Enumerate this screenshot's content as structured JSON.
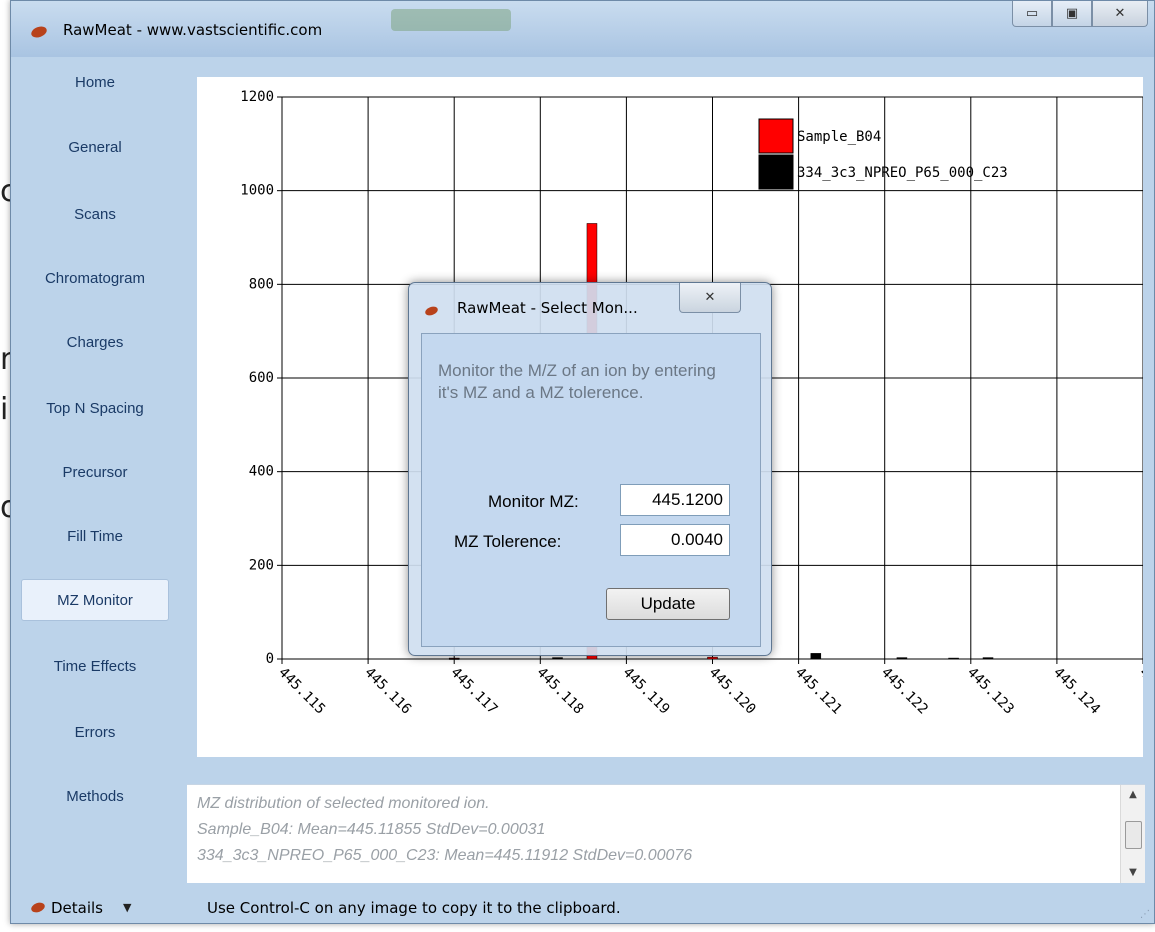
{
  "window": {
    "title": "RawMeat - www.vastscientific.com",
    "controls": [
      "minimize",
      "maximize",
      "close"
    ]
  },
  "sidebar": {
    "items": [
      {
        "label": "Home"
      },
      {
        "label": "General"
      },
      {
        "label": "Scans"
      },
      {
        "label": "Chromatogram"
      },
      {
        "label": "Charges"
      },
      {
        "label": "Top N Spacing"
      },
      {
        "label": "Precursor"
      },
      {
        "label": "Fill Time"
      },
      {
        "label": "MZ Monitor",
        "active": true
      },
      {
        "label": "Time Effects"
      },
      {
        "label": "Errors"
      },
      {
        "label": "Methods"
      }
    ]
  },
  "chart_data": {
    "type": "bar",
    "xlabel": "",
    "ylabel": "",
    "ylim": [
      0,
      1200
    ],
    "yticks": [
      0,
      200,
      400,
      600,
      800,
      1000,
      1200
    ],
    "xlim": [
      445.115,
      445.125
    ],
    "xticks": [
      "445.115",
      "445.116",
      "445.117",
      "445.118",
      "445.119",
      "445.120",
      "445.121",
      "445.122",
      "445.123",
      "445.124",
      "445.12"
    ],
    "grid": true,
    "legend_position": "top-right",
    "series": [
      {
        "name": "Sample_B04",
        "color": "#ff0000",
        "x": [
          445.117,
          445.1186,
          445.12
        ],
        "values": [
          2,
          930,
          4
        ]
      },
      {
        "name": "334_3c3_NPREO_P65_000_C23",
        "color": "#000000",
        "x": [
          445.117,
          445.1182,
          445.1212,
          445.1222,
          445.1228,
          445.1232
        ],
        "values": [
          1,
          3,
          12,
          3,
          2,
          3
        ]
      }
    ]
  },
  "info": {
    "lines": [
      "MZ distribution of selected monitored ion.",
      "Sample_B04: Mean=445.11855 StdDev=0.00031",
      "334_3c3_NPREO_P65_000_C23: Mean=445.11912 StdDev=0.00076"
    ]
  },
  "statusbar": {
    "details_label": "Details",
    "text": "Use Control-C on any image to copy it to the clipboard."
  },
  "dialog": {
    "title": "RawMeat - Select Mon...",
    "description": "Monitor the M/Z of an ion by entering it's MZ and a MZ tolerence.",
    "monitor_label": "Monitor MZ:",
    "monitor_value": "445.1200",
    "tolerance_label": "MZ Tolerence:",
    "tolerance_value": "0.0040",
    "update_label": "Update",
    "close_glyph": "✕"
  },
  "background_fragments": [
    "c",
    "n",
    "i",
    "o"
  ]
}
